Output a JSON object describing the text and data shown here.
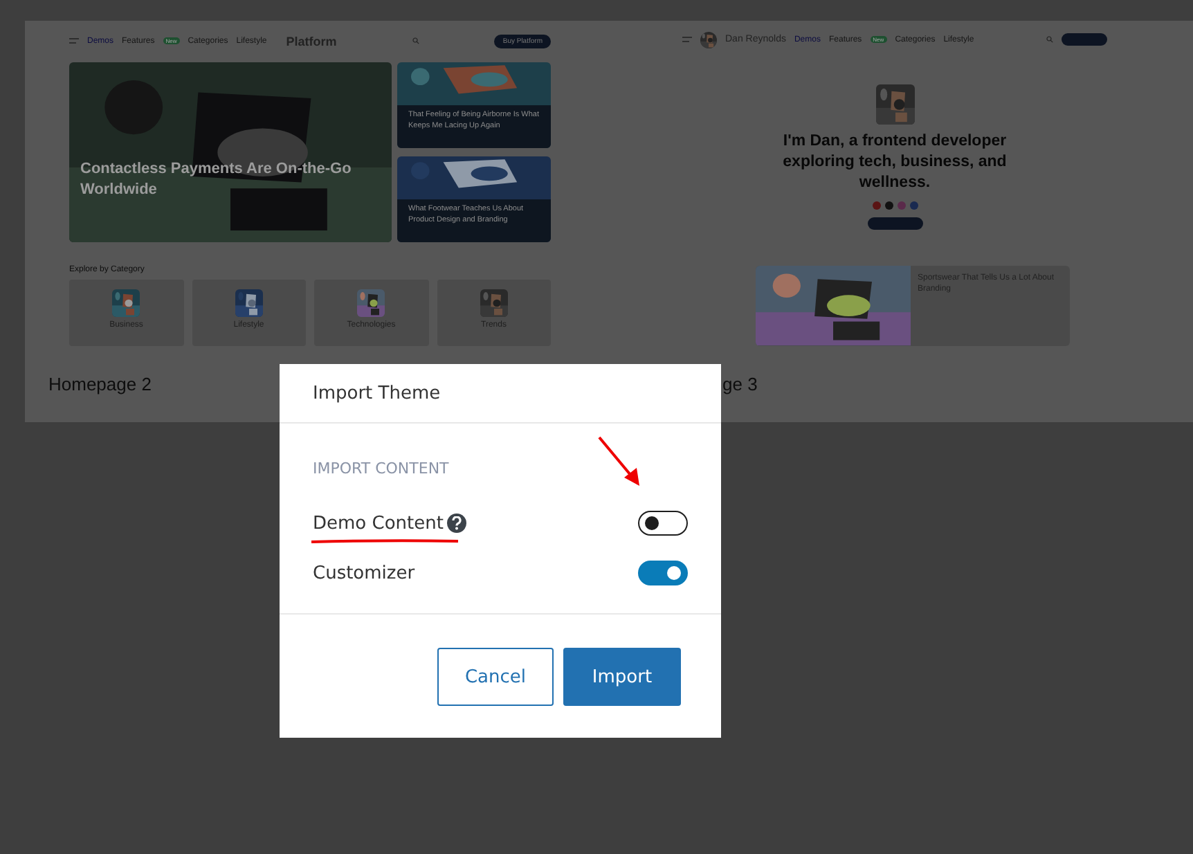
{
  "theme_cards": [
    {
      "kind": "magazine",
      "label": "Homepage 2",
      "nav": [
        "Demos",
        "Features",
        "Categories",
        "Lifestyle"
      ],
      "badge": "New",
      "logo": "Platform",
      "cta": "Buy Platform",
      "hero_title": "Contactless Payments Are On-the-Go Worldwide",
      "side_posts": [
        "That Feeling of Being Airborne Is What Keeps Me Lacing Up Again",
        "What Footwear Teaches Us About Product Design and Branding"
      ],
      "section_title": "Explore by Category",
      "categories": [
        "Business",
        "Lifestyle",
        "Technologies",
        "Trends"
      ]
    },
    {
      "kind": "personal",
      "label": "ge 3",
      "nav": [
        "Demos",
        "Features",
        "Categories",
        "Lifestyle"
      ],
      "badge": "New",
      "logo": "Dan Reynolds",
      "hero_title": "I'm Dan, a frontend developer exploring tech, business, and wellness.",
      "post_title": "Sportswear That Tells Us a Lot About Branding"
    }
  ],
  "dialog": {
    "title": "Import Theme",
    "section": "IMPORT CONTENT",
    "options": [
      {
        "label": "Demo Content",
        "help": true,
        "on": false,
        "highlighted": true
      },
      {
        "label": "Customizer",
        "help": false,
        "on": true,
        "highlighted": false
      }
    ],
    "buttons": [
      {
        "label": "Cancel",
        "kind": "secondary"
      },
      {
        "label": "Import",
        "kind": "primary"
      }
    ]
  }
}
